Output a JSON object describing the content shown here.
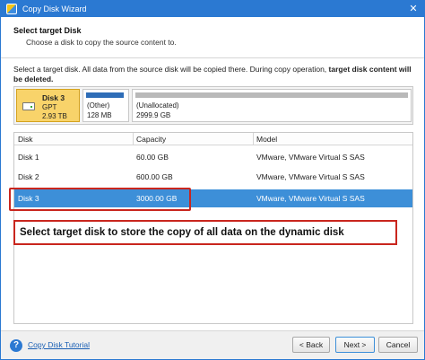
{
  "window": {
    "title": "Copy Disk Wizard",
    "close_glyph": "✕"
  },
  "header": {
    "title": "Select target Disk",
    "subtitle": "Choose a disk to copy the source content to."
  },
  "instructions": {
    "text": "Select a target disk. All data from the source disk will be copied there. During copy operation,",
    "emphasis": "target disk content will be deleted."
  },
  "diskmap": {
    "disk": {
      "name": "Disk 3",
      "type": "GPT",
      "size": "2.93 TB"
    },
    "partitions": [
      {
        "name": "(Other)",
        "size": "128 MB",
        "bar_color": "#2e6db7"
      },
      {
        "name": "(Unallocated)",
        "size": "2999.9 GB",
        "bar_color": "#b9b9b9"
      }
    ]
  },
  "table": {
    "columns": [
      "Disk",
      "Capacity",
      "Model"
    ],
    "rows": [
      {
        "disk": "Disk 1",
        "capacity": "60.00 GB",
        "model": "VMware, VMware Virtual S SAS"
      },
      {
        "disk": "Disk 2",
        "capacity": "600.00 GB",
        "model": "VMware, VMware Virtual S SAS"
      },
      {
        "disk": "Disk 3",
        "capacity": "3000.00 GB",
        "model": "VMware, VMware Virtual S SAS"
      }
    ],
    "selected_row": 2
  },
  "callout": {
    "text": "Select target disk to store the copy of all data on the dynamic disk"
  },
  "footer": {
    "help_glyph": "?",
    "tutorial_label": "Copy Disk Tutorial",
    "back_label": "< Back",
    "next_label": "Next >",
    "cancel_label": "Cancel"
  },
  "colors": {
    "accent": "#2b79d2",
    "selection": "#3d8fd8",
    "callout_border": "#c9261e",
    "disk_label": "#f8d36a"
  }
}
